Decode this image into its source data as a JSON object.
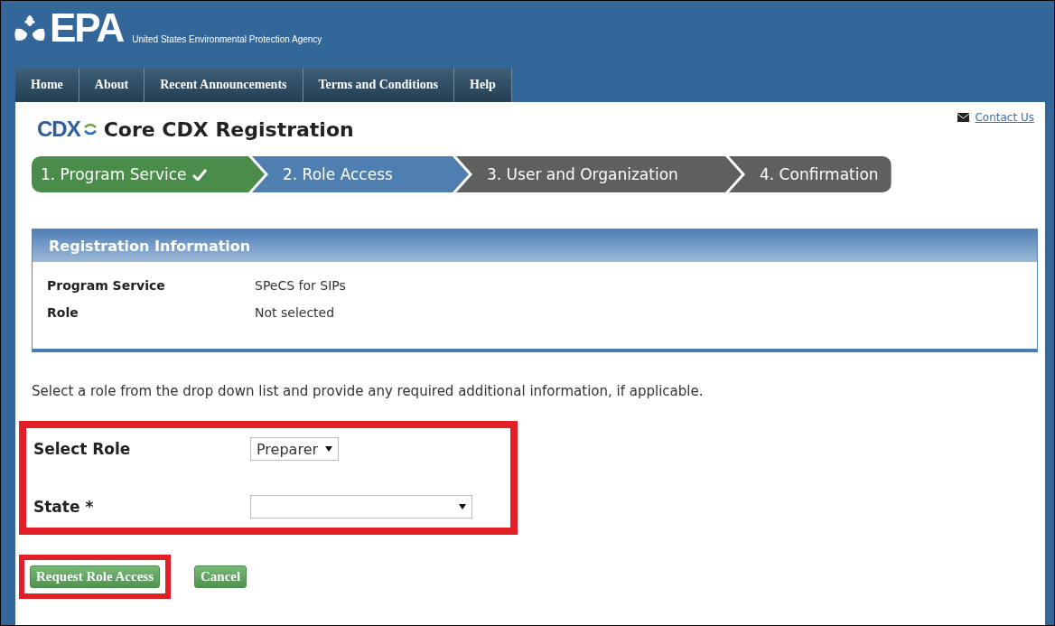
{
  "header": {
    "logo": "EPA",
    "agency": "United States Environmental Protection Agency"
  },
  "nav": [
    {
      "label": "Home"
    },
    {
      "label": "About"
    },
    {
      "label": "Recent Announcements"
    },
    {
      "label": "Terms and Conditions"
    },
    {
      "label": "Help"
    }
  ],
  "page": {
    "logo": "CDX",
    "title": "Core CDX Registration",
    "contact": "Contact Us"
  },
  "steps": [
    {
      "label": "1. Program Service",
      "completed": true,
      "selected": false
    },
    {
      "label": "2. Role Access",
      "completed": false,
      "selected": true
    },
    {
      "label": "3. User and Organization",
      "completed": false,
      "selected": false
    },
    {
      "label": "4. Confirmation",
      "completed": false,
      "selected": false
    }
  ],
  "registration": {
    "title": "Registration Information",
    "rows": [
      {
        "label": "Program Service",
        "value": "SPeCS for SIPs"
      },
      {
        "label": "Role",
        "value": "Not selected"
      }
    ]
  },
  "instructions": "Select a role from the drop down list and provide any required additional information, if applicable.",
  "form": {
    "highlighted": true,
    "fields": [
      {
        "label": "Select Role",
        "value": "Preparer",
        "wide": false
      },
      {
        "label": "State *",
        "wide": true
      }
    ]
  },
  "buttons": [
    {
      "label": "Request Role Access",
      "highlighted": true
    },
    {
      "label": "Cancel",
      "highlighted": false
    }
  ]
}
